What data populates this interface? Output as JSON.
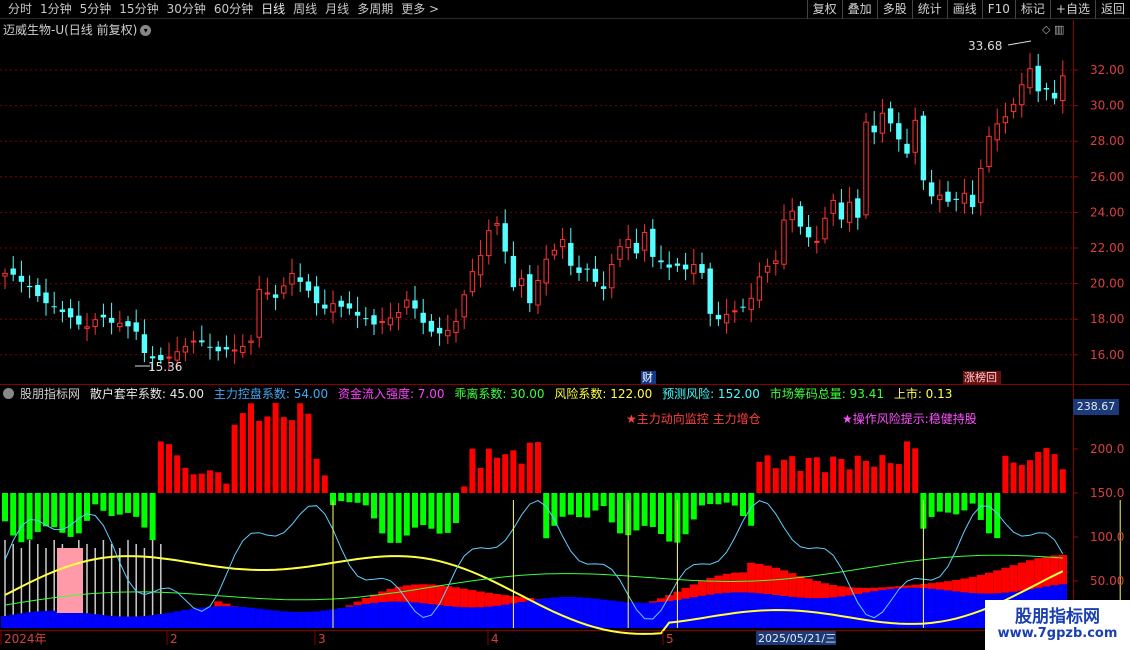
{
  "toolbar": {
    "periods": [
      "分时",
      "1分钟",
      "5分钟",
      "15分钟",
      "30分钟",
      "60分钟",
      "日线",
      "周线",
      "月线",
      "多周期",
      "更多"
    ],
    "more_arrow": ">",
    "buttons": [
      "复权",
      "叠加",
      "多股",
      "统计",
      "画线",
      "F10",
      "标记",
      "+自选",
      "返回"
    ]
  },
  "stock": {
    "title": "迈威生物-U(日线 前复权)",
    "max_label": "33.68",
    "min_label": "15.36",
    "tag_finance": "财",
    "tag_rank": "涨榜回"
  },
  "price_axis": {
    "ticks": [
      "32.00",
      "30.00",
      "28.00",
      "26.00",
      "24.00",
      "22.00",
      "20.00",
      "18.00",
      "16.00"
    ]
  },
  "indicator": {
    "name": "股朋指标网",
    "items": [
      {
        "label": "散户套牢系数: 45.00",
        "color": "#e8e8e8"
      },
      {
        "label": "主力控盘系数: 54.00",
        "color": "#3fa9f5"
      },
      {
        "label": "资金流入强度: 7.00",
        "color": "#ff40ff"
      },
      {
        "label": "乖离系数: 30.00",
        "color": "#3cff3c"
      },
      {
        "label": "风险系数: 122.00",
        "color": "#ffff40"
      },
      {
        "label": "预测风险: 152.00",
        "color": "#40ffff"
      },
      {
        "label": "市场筹码总量: 93.41",
        "color": "#3cff3c"
      },
      {
        "label": "上市: 0.13",
        "color": "#ffff40"
      }
    ],
    "note1": "★主力动向监控 主力增仓",
    "note2": "★操作风险提示:稳健持股",
    "value_box": "238.67",
    "ticks": [
      "200.0",
      "150.0",
      "100.0",
      "50.00"
    ]
  },
  "dates": {
    "labels": [
      "2024年",
      "2",
      "3",
      "4",
      "5"
    ],
    "cursor_date": "2025/05/21/三"
  },
  "watermark": {
    "line1": "股朋指标网",
    "line2": "www.7gpzb.com"
  },
  "colors": {
    "up": "#ff3232",
    "down": "#54ffff",
    "grid": "#7a0000",
    "bar_red": "#ff0000",
    "bar_green": "#00ff00",
    "blue": "#0000ff"
  }
}
